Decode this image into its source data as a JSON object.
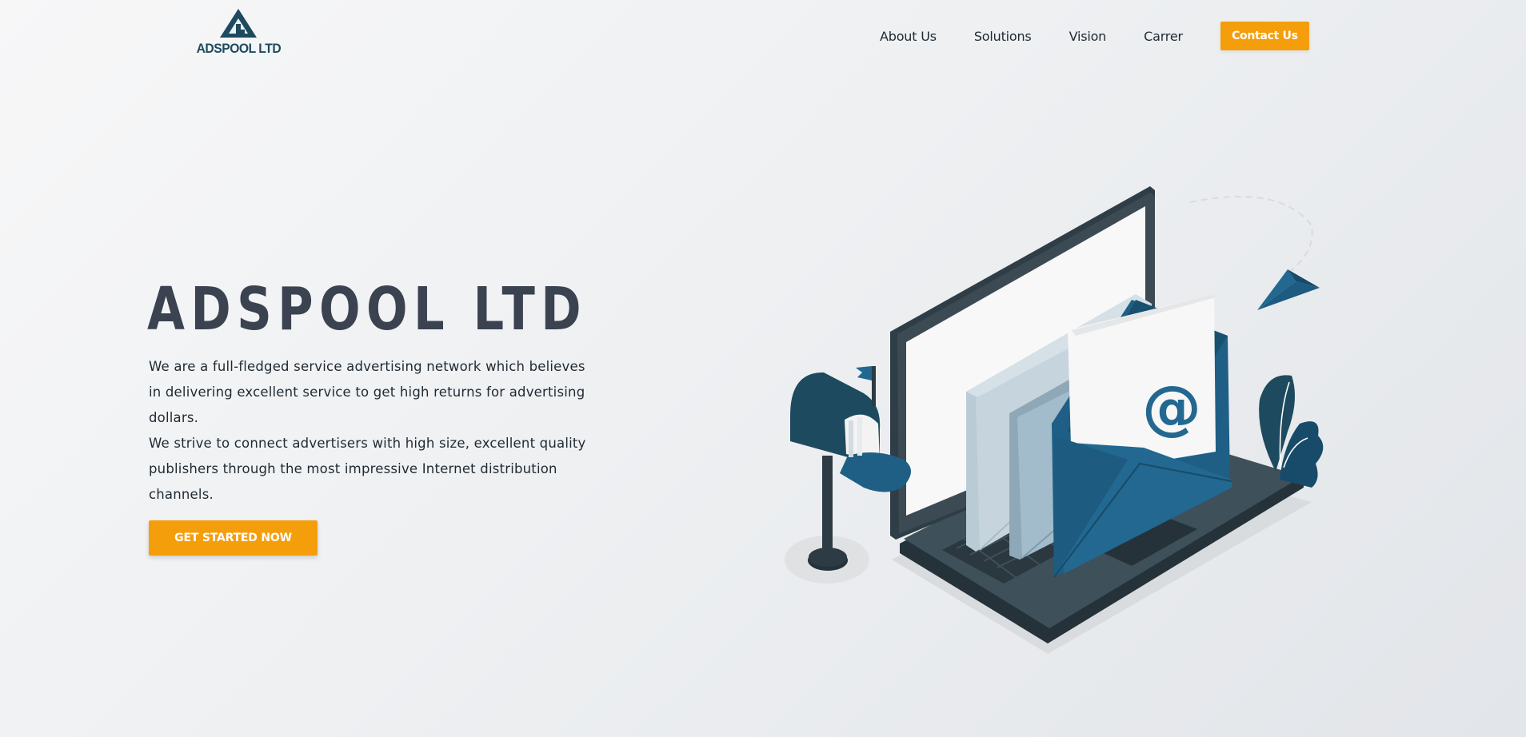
{
  "brand": {
    "logo_text": "ADSPOOL LTD",
    "accent": "#f59e0b",
    "primary": "#1d4a5e"
  },
  "nav": {
    "links": [
      "About Us",
      "Solutions",
      "Vision",
      "Carrer"
    ],
    "contact_label": "Contact Us"
  },
  "hero": {
    "title": "ADSPOOL LTD",
    "line1": "We are a full-fledged service advertising network which believes",
    "line2": "in delivering excellent service to get high returns for advertising",
    "line3": "dollars.",
    "line4": "We strive to connect advertisers with high size, excellent quality",
    "line5": "publishers through the most impressive Internet distribution",
    "line6": "channels.",
    "cta_label": "GET STARTED NOW"
  },
  "illustration": {
    "email_symbol": "@",
    "icons": [
      "laptop-icon",
      "mailbox-icon",
      "envelope-icon",
      "paper-plane-icon",
      "plant-icon"
    ]
  }
}
